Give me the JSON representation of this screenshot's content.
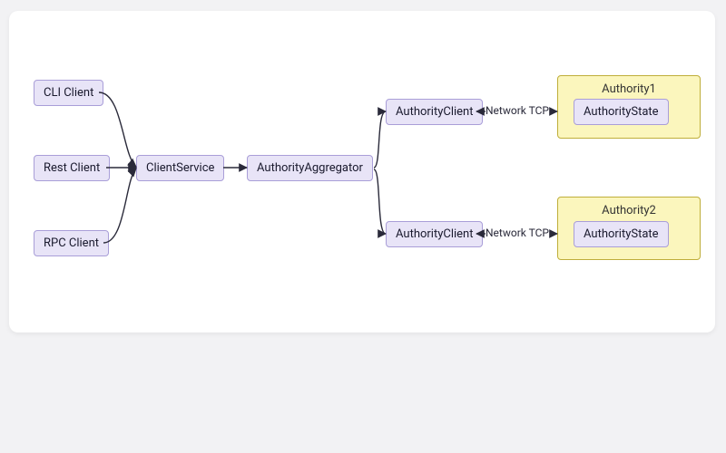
{
  "diagram": {
    "nodes": {
      "cli": {
        "label": "CLI Client"
      },
      "rest": {
        "label": "Rest Client"
      },
      "rpc": {
        "label": "RPC Client"
      },
      "clientSvc": {
        "label": "ClientService"
      },
      "agg": {
        "label": "AuthorityAggregator"
      },
      "ac1": {
        "label": "AuthorityClient"
      },
      "ac2": {
        "label": "AuthorityClient"
      },
      "as1": {
        "label": "AuthorityState"
      },
      "as2": {
        "label": "AuthorityState"
      }
    },
    "containers": {
      "auth1": {
        "title": "Authority1"
      },
      "auth2": {
        "title": "Authority2"
      }
    },
    "edgeLabels": {
      "net1": "Network TCP",
      "net2": "Network TCP"
    },
    "edgesDescription": [
      "CLI Client -> ClientService",
      "Rest Client -> ClientService",
      "RPC Client -> ClientService",
      "ClientService -> AuthorityAggregator",
      "AuthorityAggregator -> AuthorityClient (top)",
      "AuthorityAggregator -> AuthorityClient (bottom)",
      "AuthorityClient (top) <-> Authority1/AuthorityState  [Network TCP]",
      "AuthorityClient (bottom) <-> Authority2/AuthorityState  [Network TCP]"
    ]
  }
}
